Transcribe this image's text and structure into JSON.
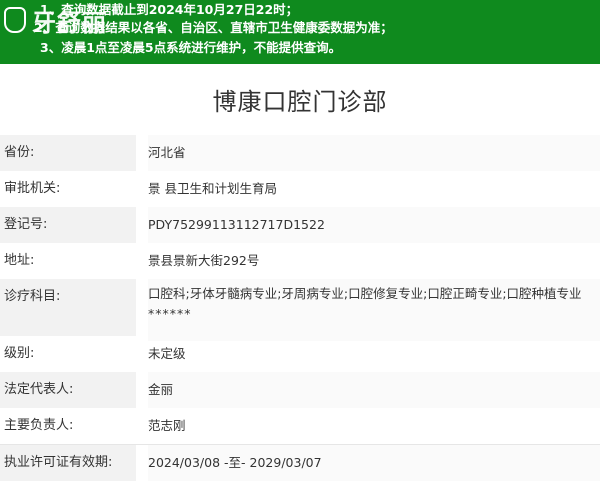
{
  "logo": {
    "text": "牙舒丽"
  },
  "notices": [
    "1、查询数据截止到2024年10月27日22时；",
    "2、查询数据结果以各省、自治区、直辖市卫生健康委数据为准；",
    "3、凌晨1点至凌晨5点系统进行维护，不能提供查询。"
  ],
  "title": "博康口腔门诊部",
  "rows": [
    {
      "label": "省份:",
      "value": "河北省"
    },
    {
      "label": "审批机关:",
      "value": "景 县卫生和计划生育局"
    },
    {
      "label": "登记号:",
      "value": "PDY75299113112717D1522"
    },
    {
      "label": "地址:",
      "value": "景县景新大街292号"
    },
    {
      "label": "诊疗科目:",
      "value": "口腔科;牙体牙髓病专业;牙周病专业;口腔修复专业;口腔正畸专业;口腔种植专业",
      "value2": "******"
    },
    {
      "label": "级别:",
      "value": "未定级"
    },
    {
      "label": "法定代表人:",
      "value": "金丽"
    },
    {
      "label": "主要负责人:",
      "value": "范志刚"
    },
    {
      "label": "执业许可证有效期:",
      "value": "2024/03/08 -至- 2029/03/07"
    }
  ]
}
